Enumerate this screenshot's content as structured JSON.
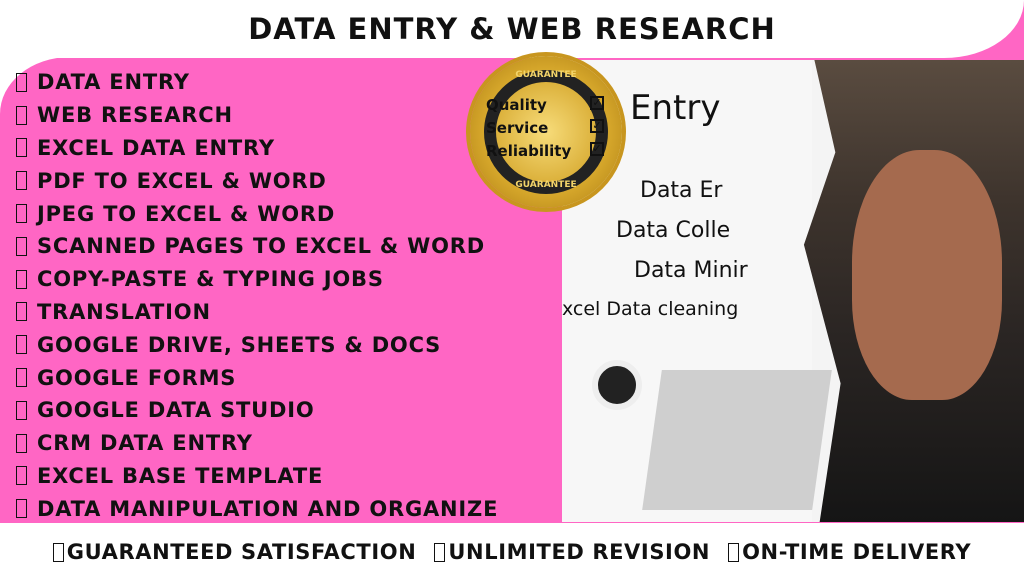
{
  "header": {
    "title": "DATA ENTRY & WEB RESEARCH"
  },
  "services": [
    "DATA ENTRY",
    "WEB RESEARCH",
    "EXCEL DATA ENTRY",
    "PDF TO EXCEL & WORD",
    "JPEG TO EXCEL & WORD",
    "SCANNED PAGES TO EXCEL & WORD",
    "COPY-PASTE & TYPING JOBS",
    "TRANSLATION",
    "GOOGLE DRIVE, SHEETS & DOCS",
    "GOOGLE FORMS",
    "GOOGLE DATA STUDIO",
    "CRM DATA ENTRY",
    "EXCEL BASE TEMPLATE",
    "DATA MANIPULATION AND ORGANIZE"
  ],
  "seal": {
    "top": "GUARANTEE",
    "bottom": "GUARANTEE",
    "rows": [
      "Quality",
      "Service",
      "Reliability"
    ]
  },
  "photo": {
    "lines": [
      "Entry",
      "Data Er",
      "Data Colle",
      "Data Minir",
      "xcel Data cleaning"
    ]
  },
  "footer": [
    "GUARANTEED SATISFACTION",
    "UNLIMITED REVISION",
    "ON-TIME DELIVERY"
  ],
  "colors": {
    "accent": "#ff66c4",
    "gold": "#d4a52a"
  }
}
